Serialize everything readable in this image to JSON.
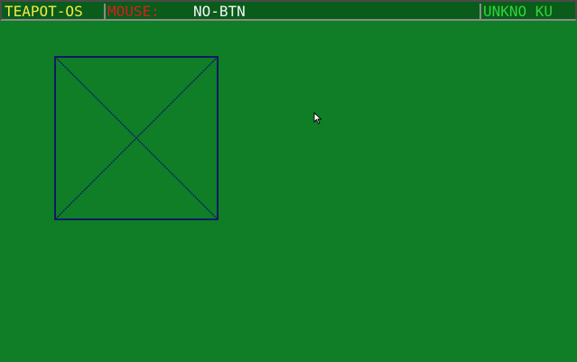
{
  "status_bar": {
    "os_name": "TEAPOT-OS",
    "mouse_label": "MOUSE:",
    "mouse_status": "NO-BTN",
    "keyboard_status": "UNKNO KU"
  },
  "colors": {
    "desktop_background": "#0f7e27",
    "os_name": "#f2e84a",
    "mouse_label": "#d42020",
    "mouse_status": "#f4f4f4",
    "keyboard_status": "#2fd43a",
    "box_stroke": "#0c1a63"
  },
  "canvas": {
    "shape": "square-with-diagonal-cross",
    "cursor_icon": "arrow-cursor-icon"
  }
}
